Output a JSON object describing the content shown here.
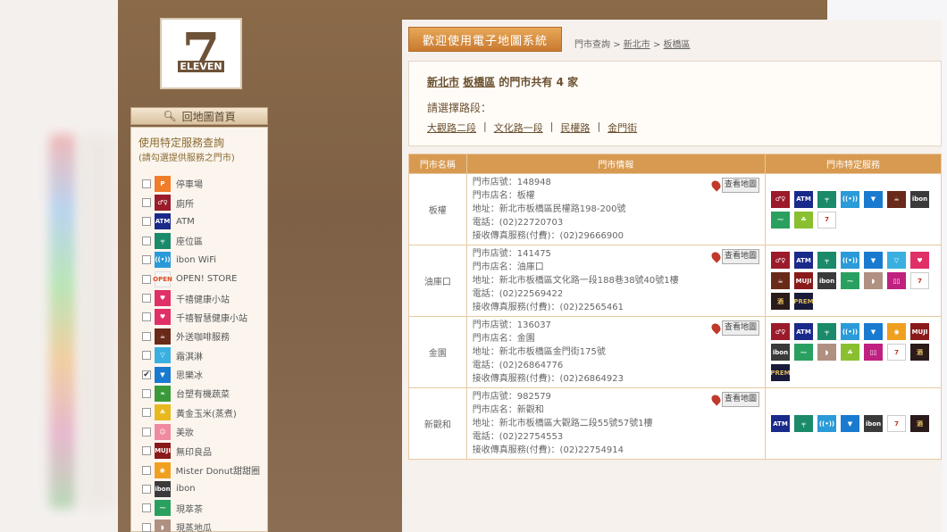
{
  "logo": {
    "text": "7",
    "subtext": "ELEVEN"
  },
  "home_button": {
    "label": "回地圖首頁"
  },
  "sidebar": {
    "title": "使用特定服務查詢",
    "subtitle": "(請勾選提供服務之門市)",
    "items": [
      {
        "label": "停車場",
        "checked": false,
        "icon": "parking-icon",
        "glyph": "P"
      },
      {
        "label": "廁所",
        "checked": false,
        "icon": "restroom-icon",
        "glyph": "♂♀"
      },
      {
        "label": "ATM",
        "checked": false,
        "icon": "atm-icon",
        "glyph": "ATM"
      },
      {
        "label": "座位區",
        "checked": false,
        "icon": "seating-icon",
        "glyph": "╤"
      },
      {
        "label": "ibon WiFi",
        "checked": false,
        "icon": "wifi-icon",
        "glyph": "((•))"
      },
      {
        "label": "OPEN! STORE",
        "checked": false,
        "icon": "open-store-icon",
        "glyph": "OPEN"
      },
      {
        "label": "千禧健康小站",
        "checked": false,
        "icon": "health-station-icon",
        "glyph": "♥"
      },
      {
        "label": "千禧智慧健康小站",
        "checked": false,
        "icon": "smart-health-icon",
        "glyph": "♥"
      },
      {
        "label": "外送咖啡服務",
        "checked": false,
        "icon": "coffee-delivery-icon",
        "glyph": "☕"
      },
      {
        "label": "霜淇淋",
        "checked": false,
        "icon": "ice-cream-icon",
        "glyph": "▽"
      },
      {
        "label": "思樂冰",
        "checked": true,
        "icon": "slurpee-icon",
        "glyph": "▼"
      },
      {
        "label": "台塑有機蔬菜",
        "checked": false,
        "icon": "organic-veg-icon",
        "glyph": "❧"
      },
      {
        "label": "黃金玉米(蒸煮)",
        "checked": false,
        "icon": "corn-icon",
        "glyph": "☘"
      },
      {
        "label": "美妝",
        "checked": false,
        "icon": "beauty-icon",
        "glyph": "☺"
      },
      {
        "label": "無印良品",
        "checked": false,
        "icon": "muji-icon",
        "glyph": "MUJI"
      },
      {
        "label": "Mister Donut甜甜圈",
        "checked": false,
        "icon": "donut-icon",
        "glyph": "◉"
      },
      {
        "label": "ibon",
        "checked": false,
        "icon": "ibon-icon",
        "glyph": "ibon"
      },
      {
        "label": "現萃茶",
        "checked": false,
        "icon": "tea-icon",
        "glyph": "⁓"
      },
      {
        "label": "現蒸地瓜",
        "checked": false,
        "icon": "sweet-potato-icon",
        "glyph": "◗"
      }
    ]
  },
  "header": {
    "title": "歡迎使用電子地圖系統",
    "breadcrumb": {
      "root": "門市查詢",
      "sep1": ">",
      "city": "新北市",
      "sep2": ">",
      "district": "板橋區"
    }
  },
  "info": {
    "city": "新北市",
    "district": "板橋區",
    "suffix": "的門市共有 4 家",
    "route_label": "請選擇路段：",
    "routes": [
      "大觀路二段",
      "文化路一段",
      "民權路",
      "金門街"
    ],
    "route_sep": "|"
  },
  "table": {
    "headers": [
      "門市名稱",
      "門市情報",
      "門市特定服務"
    ],
    "map_button": "查看地圖",
    "rows": [
      {
        "name": "板權",
        "lines": [
          "門市店號：148948",
          "門市店名：板權",
          "地址：新北市板橋區民權路198-200號",
          "電話：(02)22720703",
          "接收傳真服務(付費)：(02)29666900"
        ],
        "services": [
          {
            "c": "c-wc",
            "g": "♂♀",
            "n": "restroom-icon"
          },
          {
            "c": "c-atm",
            "g": "ATM",
            "n": "atm-icon"
          },
          {
            "c": "c-seat",
            "g": "╤",
            "n": "seating-icon"
          },
          {
            "c": "c-wifi",
            "g": "((•))",
            "n": "wifi-icon"
          },
          {
            "c": "c-slurpee",
            "g": "▼",
            "n": "slurpee-icon"
          },
          {
            "c": "c-coffee",
            "g": "☕",
            "n": "coffee-delivery-icon"
          },
          {
            "c": "c-ibon",
            "g": "ibon",
            "n": "ibon-icon"
          },
          {
            "c": "c-tea",
            "g": "⁓",
            "n": "tea-icon"
          },
          {
            "c": "c-corn2",
            "g": "☘",
            "n": "corn-icon"
          },
          {
            "c": "c-seven",
            "g": "7",
            "n": "seven-icon"
          }
        ]
      },
      {
        "name": "油庫口",
        "lines": [
          "門市店號：141475",
          "門市店名：油庫口",
          "地址：新北市板橋區文化路一段188巷38號40號1樓",
          "電話：(02)22569422",
          "接收傳真服務(付費)：(02)22565461"
        ],
        "services": [
          {
            "c": "c-wc",
            "g": "♂♀",
            "n": "restroom-icon"
          },
          {
            "c": "c-atm",
            "g": "ATM",
            "n": "atm-icon"
          },
          {
            "c": "c-seat",
            "g": "╤",
            "n": "seating-icon"
          },
          {
            "c": "c-wifi",
            "g": "((•))",
            "n": "wifi-icon"
          },
          {
            "c": "c-slurpee",
            "g": "▼",
            "n": "slurpee-icon"
          },
          {
            "c": "c-icecream",
            "g": "▽",
            "n": "ice-cream-icon"
          },
          {
            "c": "c-health",
            "g": "♥",
            "n": "health-station-icon"
          },
          {
            "c": "c-coffee",
            "g": "☕",
            "n": "coffee-delivery-icon"
          },
          {
            "c": "c-muji",
            "g": "MUJI",
            "n": "muji-icon"
          },
          {
            "c": "c-ibon",
            "g": "ibon",
            "n": "ibon-icon"
          },
          {
            "c": "c-tea",
            "g": "⁓",
            "n": "tea-icon"
          },
          {
            "c": "c-sweetpotato",
            "g": "◗",
            "n": "sweet-potato-icon"
          },
          {
            "c": "c-book",
            "g": "▯▯",
            "n": "book-icon"
          },
          {
            "c": "c-seven",
            "g": "7",
            "n": "seven-icon"
          },
          {
            "c": "c-wine",
            "g": "酒",
            "n": "wine-icon"
          },
          {
            "c": "c-premium",
            "g": "PREM",
            "n": "premium-icon"
          }
        ]
      },
      {
        "name": "金園",
        "lines": [
          "門市店號：136037",
          "門市店名：金園",
          "地址：新北市板橋區金門街175號",
          "電話：(02)26864776",
          "接收傳真服務(付費)：(02)26864923"
        ],
        "services": [
          {
            "c": "c-wc",
            "g": "♂♀",
            "n": "restroom-icon"
          },
          {
            "c": "c-atm",
            "g": "ATM",
            "n": "atm-icon"
          },
          {
            "c": "c-seat",
            "g": "╤",
            "n": "seating-icon"
          },
          {
            "c": "c-wifi",
            "g": "((•))",
            "n": "wifi-icon"
          },
          {
            "c": "c-slurpee",
            "g": "▼",
            "n": "slurpee-icon"
          },
          {
            "c": "c-donut",
            "g": "◉",
            "n": "donut-icon"
          },
          {
            "c": "c-muji",
            "g": "MUJI",
            "n": "muji-icon"
          },
          {
            "c": "c-ibon",
            "g": "ibon",
            "n": "ibon-icon"
          },
          {
            "c": "c-tea",
            "g": "⁓",
            "n": "tea-icon"
          },
          {
            "c": "c-sweetpotato",
            "g": "◗",
            "n": "sweet-potato-icon"
          },
          {
            "c": "c-corn2",
            "g": "☘",
            "n": "corn-icon"
          },
          {
            "c": "c-book",
            "g": "▯▯",
            "n": "book-icon"
          },
          {
            "c": "c-seven",
            "g": "7",
            "n": "seven-icon"
          },
          {
            "c": "c-wine",
            "g": "酒",
            "n": "wine-icon"
          },
          {
            "c": "c-premium",
            "g": "PREM",
            "n": "premium-icon"
          }
        ]
      },
      {
        "name": "新觀和",
        "lines": [
          "門市店號：982579",
          "門市店名：新觀和",
          "地址：新北市板橋區大觀路二段55號57號1樓",
          "電話：(02)22754553",
          "接收傳真服務(付費)：(02)22754914"
        ],
        "services": [
          {
            "c": "c-atm",
            "g": "ATM",
            "n": "atm-icon"
          },
          {
            "c": "c-seat",
            "g": "╤",
            "n": "seating-icon"
          },
          {
            "c": "c-wifi",
            "g": "((•))",
            "n": "wifi-icon"
          },
          {
            "c": "c-slurpee",
            "g": "▼",
            "n": "slurpee-icon"
          },
          {
            "c": "c-ibon",
            "g": "ibon",
            "n": "ibon-icon"
          },
          {
            "c": "c-seven",
            "g": "7",
            "n": "seven-icon"
          },
          {
            "c": "c-wine",
            "g": "酒",
            "n": "wine-icon"
          }
        ]
      }
    ]
  }
}
